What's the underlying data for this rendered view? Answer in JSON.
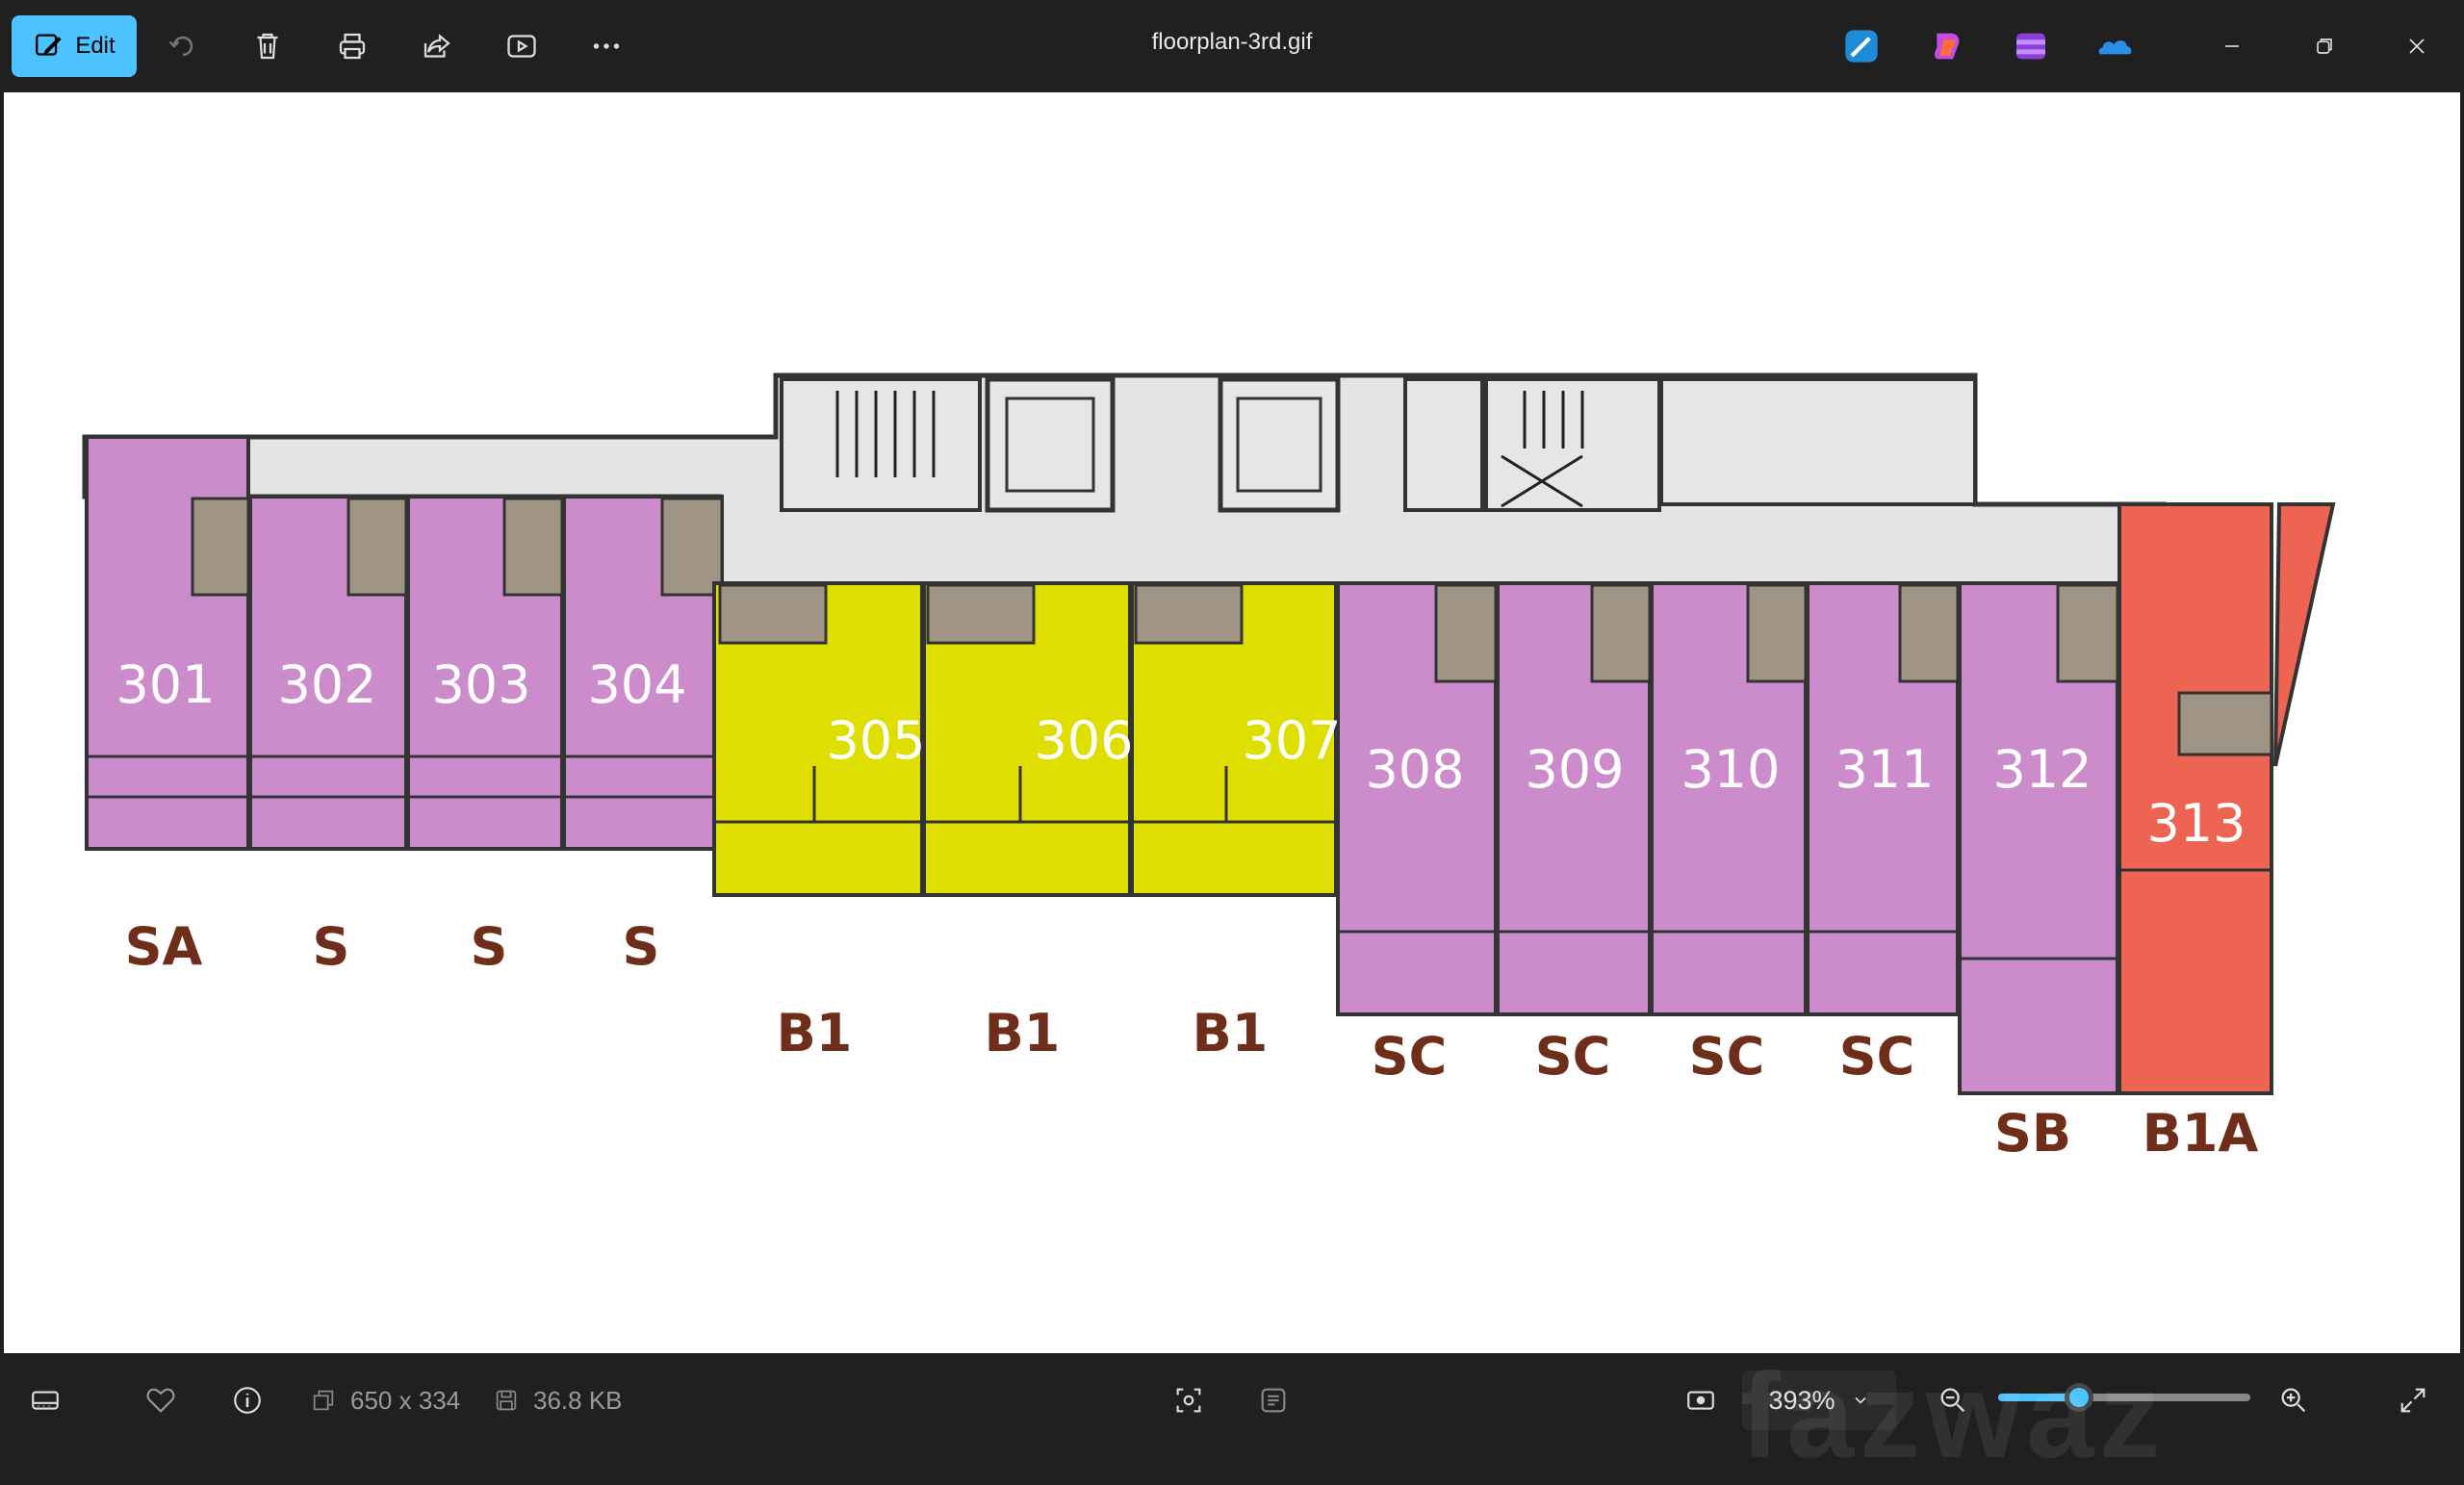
{
  "toolbar": {
    "edit_label": "Edit",
    "tools": [
      "rotate-icon",
      "trash-icon",
      "print-icon",
      "share-icon",
      "slideshow-icon",
      "more-icon"
    ]
  },
  "window": {
    "title": "floorplan-3rd.gif",
    "apps": [
      "designer-app-icon",
      "copilot-app-icon",
      "clipchamp-app-icon",
      "onedrive-app-icon"
    ]
  },
  "floorplan": {
    "units": [
      {
        "number": "301",
        "type": "SA",
        "color": "#cc8ccc"
      },
      {
        "number": "302",
        "type": "S",
        "color": "#cc8ccc"
      },
      {
        "number": "303",
        "type": "S",
        "color": "#cc8ccc"
      },
      {
        "number": "304",
        "type": "S",
        "color": "#cc8ccc"
      },
      {
        "number": "305",
        "type": "B1",
        "color": "#dede00"
      },
      {
        "number": "306",
        "type": "B1",
        "color": "#dede00"
      },
      {
        "number": "307",
        "type": "B1",
        "color": "#dede00"
      },
      {
        "number": "308",
        "type": "SC",
        "color": "#cc8ccc"
      },
      {
        "number": "309",
        "type": "SC",
        "color": "#cc8ccc"
      },
      {
        "number": "310",
        "type": "SC",
        "color": "#cc8ccc"
      },
      {
        "number": "311",
        "type": "SC",
        "color": "#cc8ccc"
      },
      {
        "number": "312",
        "type": "SB",
        "color": "#cc8ccc"
      },
      {
        "number": "313",
        "type": "B1A",
        "color": "#ee6452"
      }
    ]
  },
  "status": {
    "dimensions": "650 x 334",
    "file_size": "36.8 KB",
    "zoom": "393%",
    "zoom_fraction": 0.32,
    "watermark": "fazwaz"
  }
}
